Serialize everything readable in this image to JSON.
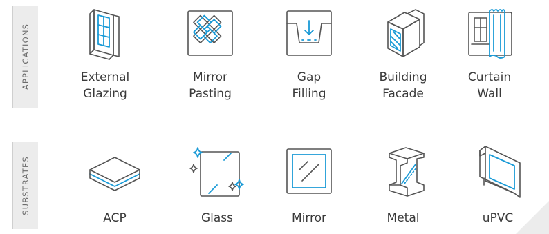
{
  "sections": {
    "applications": "APPLICATIONS",
    "substrates": "SUBSTRATES"
  },
  "applications": [
    {
      "line1": "External",
      "line2": "Glazing",
      "icon": "external-glazing-icon"
    },
    {
      "line1": "Mirror",
      "line2": "Pasting",
      "icon": "mirror-pasting-icon"
    },
    {
      "line1": "Gap",
      "line2": "Filling",
      "icon": "gap-filling-icon"
    },
    {
      "line1": "Building",
      "line2": "Facade",
      "icon": "building-facade-icon"
    },
    {
      "line1": "Curtain",
      "line2": "Wall",
      "icon": "curtain-wall-icon"
    }
  ],
  "substrates": [
    {
      "label": "ACP",
      "icon": "acp-icon"
    },
    {
      "label": "Glass",
      "icon": "glass-icon"
    },
    {
      "label": "Mirror",
      "icon": "mirror-icon"
    },
    {
      "label": "Metal",
      "icon": "metal-icon"
    },
    {
      "label": "uPVC",
      "icon": "upvc-icon"
    }
  ],
  "colors": {
    "accent": "#1a9ad6",
    "stroke": "#555555",
    "label_bg": "#ececec"
  }
}
